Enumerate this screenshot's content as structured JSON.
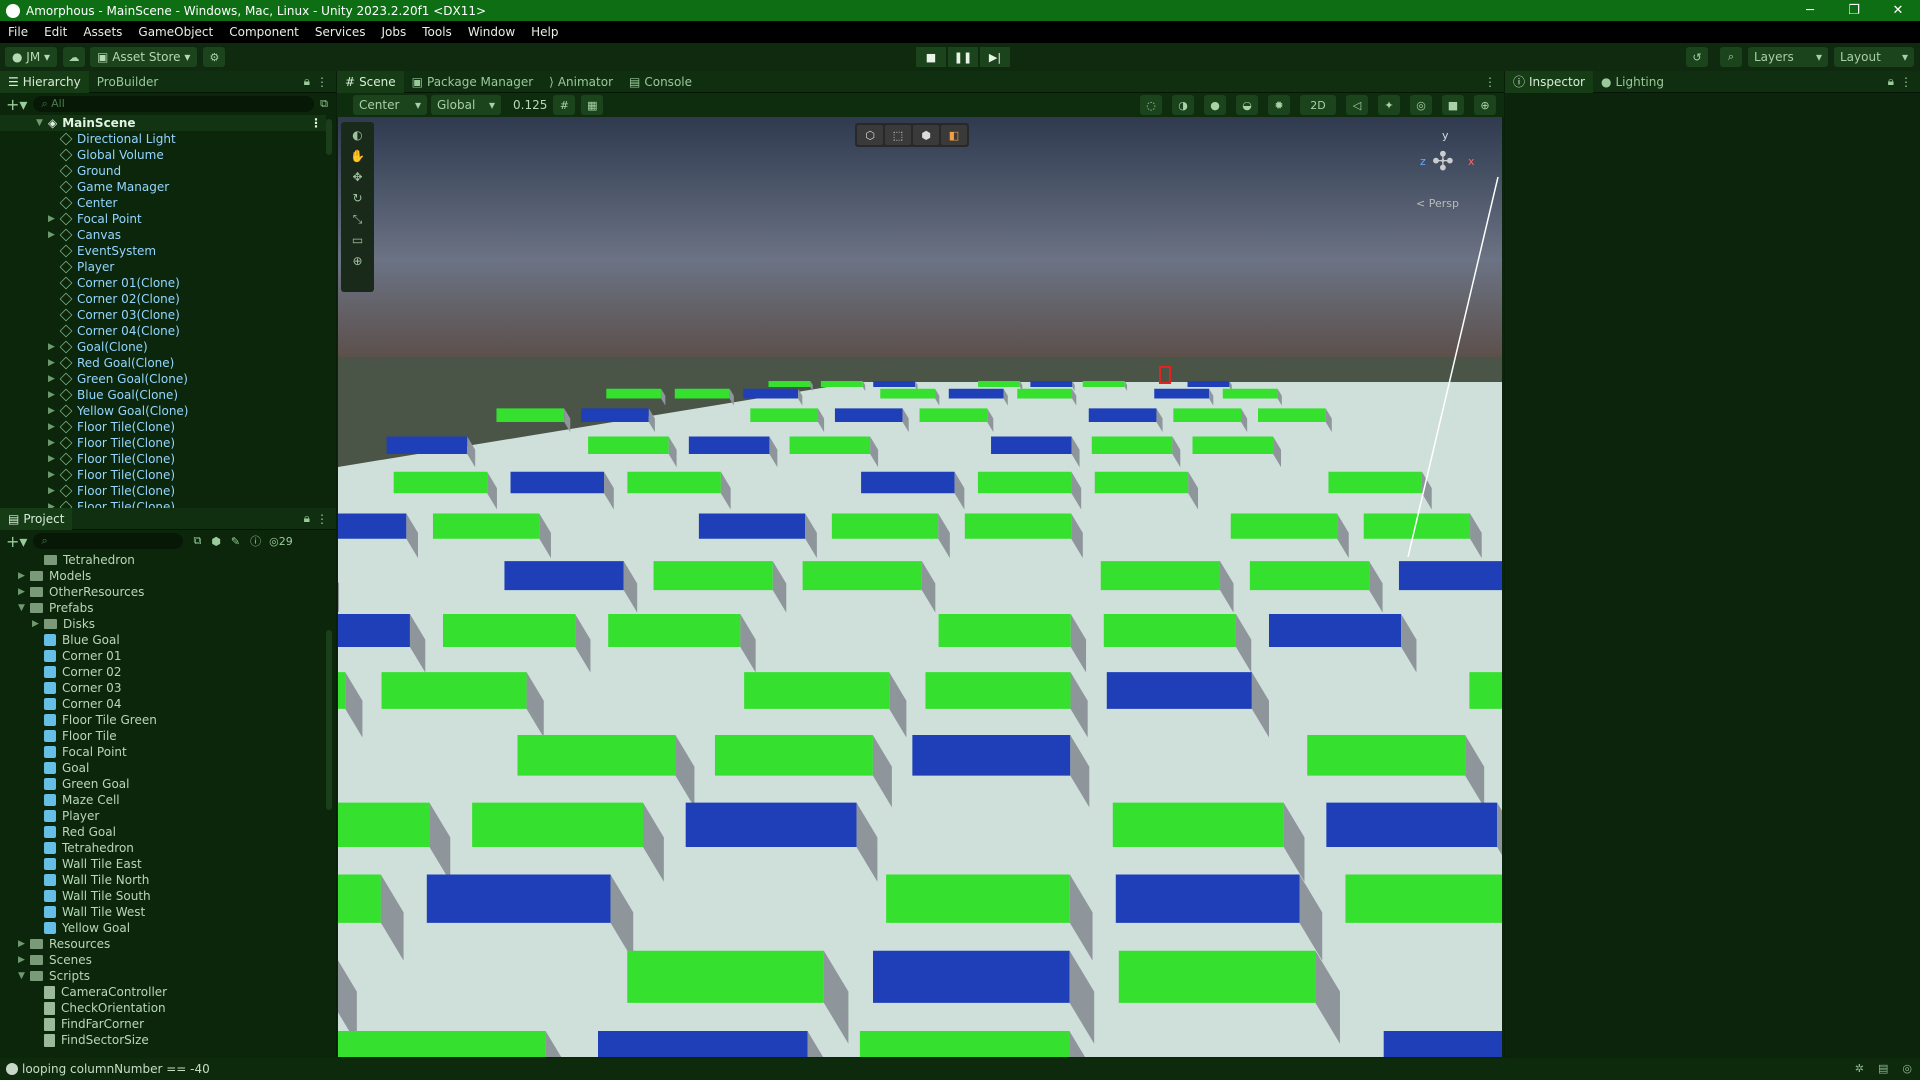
{
  "window": {
    "title": "Amorphous - MainScene - Windows, Mac, Linux - Unity 2023.2.20f1 <DX11>",
    "minimize": "─",
    "maximize": "❐",
    "close": "✕"
  },
  "menu": [
    "File",
    "Edit",
    "Assets",
    "GameObject",
    "Component",
    "Services",
    "Jobs",
    "Tools",
    "Window",
    "Help"
  ],
  "toolbar": {
    "account": "JM",
    "asset_store": "Asset Store",
    "layers": "Layers",
    "layout": "Layout"
  },
  "hierarchy": {
    "tab": "Hierarchy",
    "tab2": "ProBuilder",
    "search_placeholder": "All",
    "scene": "MainScene",
    "items": [
      {
        "label": "Directional Light",
        "arrow": ""
      },
      {
        "label": "Global Volume",
        "arrow": ""
      },
      {
        "label": "Ground",
        "arrow": ""
      },
      {
        "label": "Game Manager",
        "arrow": ""
      },
      {
        "label": "Center",
        "arrow": ""
      },
      {
        "label": "Focal Point",
        "arrow": "▶"
      },
      {
        "label": "Canvas",
        "arrow": "▶"
      },
      {
        "label": "EventSystem",
        "arrow": ""
      },
      {
        "label": "Player",
        "arrow": ""
      },
      {
        "label": "Corner 01(Clone)",
        "arrow": ""
      },
      {
        "label": "Corner 02(Clone)",
        "arrow": ""
      },
      {
        "label": "Corner 03(Clone)",
        "arrow": ""
      },
      {
        "label": "Corner 04(Clone)",
        "arrow": ""
      },
      {
        "label": "Goal(Clone)",
        "arrow": "▶"
      },
      {
        "label": "Red Goal(Clone)",
        "arrow": "▶"
      },
      {
        "label": "Green Goal(Clone)",
        "arrow": "▶"
      },
      {
        "label": "Blue Goal(Clone)",
        "arrow": "▶"
      },
      {
        "label": "Yellow Goal(Clone)",
        "arrow": "▶"
      },
      {
        "label": "Floor Tile(Clone)",
        "arrow": "▶"
      },
      {
        "label": "Floor Tile(Clone)",
        "arrow": "▶"
      },
      {
        "label": "Floor Tile(Clone)",
        "arrow": "▶"
      },
      {
        "label": "Floor Tile(Clone)",
        "arrow": "▶"
      },
      {
        "label": "Floor Tile(Clone)",
        "arrow": "▶"
      },
      {
        "label": "Floor Tile(Clone)",
        "arrow": "▶"
      }
    ]
  },
  "project": {
    "tab": "Project",
    "count": "29",
    "items": [
      {
        "label": "Tetrahedron",
        "type": "folder",
        "indent": 2
      },
      {
        "label": "Models",
        "type": "folder",
        "indent": 1,
        "arrow": "▶"
      },
      {
        "label": "OtherResources",
        "type": "folder",
        "indent": 1,
        "arrow": "▶"
      },
      {
        "label": "Prefabs",
        "type": "folder",
        "indent": 1,
        "arrow": "▼"
      },
      {
        "label": "Disks",
        "type": "folder",
        "indent": 2,
        "arrow": "▶"
      },
      {
        "label": "Blue Goal",
        "type": "prefab",
        "indent": 2
      },
      {
        "label": "Corner 01",
        "type": "prefab",
        "indent": 2
      },
      {
        "label": "Corner 02",
        "type": "prefab",
        "indent": 2
      },
      {
        "label": "Corner 03",
        "type": "prefab",
        "indent": 2
      },
      {
        "label": "Corner 04",
        "type": "prefab",
        "indent": 2
      },
      {
        "label": "Floor Tile Green",
        "type": "prefab",
        "indent": 2
      },
      {
        "label": "Floor Tile",
        "type": "prefab",
        "indent": 2
      },
      {
        "label": "Focal Point",
        "type": "prefab",
        "indent": 2
      },
      {
        "label": "Goal",
        "type": "prefab",
        "indent": 2
      },
      {
        "label": "Green Goal",
        "type": "prefab",
        "indent": 2
      },
      {
        "label": "Maze Cell",
        "type": "prefab",
        "indent": 2
      },
      {
        "label": "Player",
        "type": "prefab",
        "indent": 2
      },
      {
        "label": "Red Goal",
        "type": "prefab",
        "indent": 2
      },
      {
        "label": "Tetrahedron",
        "type": "prefab",
        "indent": 2
      },
      {
        "label": "Wall Tile East",
        "type": "prefab",
        "indent": 2
      },
      {
        "label": "Wall Tile North",
        "type": "prefab",
        "indent": 2
      },
      {
        "label": "Wall Tile South",
        "type": "prefab",
        "indent": 2
      },
      {
        "label": "Wall Tile West",
        "type": "prefab",
        "indent": 2
      },
      {
        "label": "Yellow Goal",
        "type": "prefab",
        "indent": 2
      },
      {
        "label": "Resources",
        "type": "folder",
        "indent": 1,
        "arrow": "▶"
      },
      {
        "label": "Scenes",
        "type": "folder",
        "indent": 1,
        "arrow": "▶"
      },
      {
        "label": "Scripts",
        "type": "folder",
        "indent": 1,
        "arrow": "▼"
      },
      {
        "label": "CameraController",
        "type": "script",
        "indent": 2
      },
      {
        "label": "CheckOrientation",
        "type": "script",
        "indent": 2
      },
      {
        "label": "FindFarCorner",
        "type": "script",
        "indent": 2
      },
      {
        "label": "FindSectorSize",
        "type": "script",
        "indent": 2
      }
    ]
  },
  "scene": {
    "tabs": [
      "Scene",
      "Package Manager",
      "Animator",
      "Console"
    ],
    "pivot": "Center",
    "space": "Global",
    "snap": "0.125",
    "mode_2d": "2D",
    "persp": "< Persp",
    "gizmo_y": "y",
    "gizmo_z": "z",
    "gizmo_x": "x"
  },
  "inspector": {
    "tab": "Inspector",
    "tab2": "Lighting"
  },
  "status": {
    "message": "looping columnNumber == -40"
  },
  "colors": {
    "title_bg": "#0e6e14",
    "wall_green": "#35e02e",
    "wall_blue": "#1f3fb8",
    "floor": "#cfe0da"
  }
}
